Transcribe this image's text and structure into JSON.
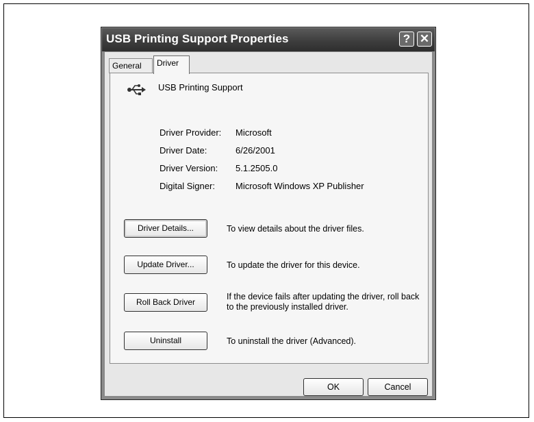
{
  "window": {
    "title": "USB Printing Support Properties",
    "help_glyph": "?",
    "close_glyph": "✕"
  },
  "tabs": [
    {
      "label": "General",
      "active": false
    },
    {
      "label": "Driver",
      "active": true
    }
  ],
  "device": {
    "icon": "usb-icon",
    "name": "USB Printing Support"
  },
  "driver_info": [
    {
      "label": "Driver Provider:",
      "value": "Microsoft"
    },
    {
      "label": "Driver Date:",
      "value": "6/26/2001"
    },
    {
      "label": "Driver Version:",
      "value": "5.1.2505.0"
    },
    {
      "label": "Digital Signer:",
      "value": "Microsoft Windows XP Publisher"
    }
  ],
  "actions": [
    {
      "label": "Driver Details...",
      "description": "To view details about the driver files."
    },
    {
      "label": "Update Driver...",
      "description": "To update the driver for this device."
    },
    {
      "label": "Roll Back Driver",
      "description": "If the device fails after updating the driver, roll back to the previously installed driver."
    },
    {
      "label": "Uninstall",
      "description": "To uninstall the driver (Advanced)."
    }
  ],
  "footer": {
    "ok_label": "OK",
    "cancel_label": "Cancel"
  }
}
